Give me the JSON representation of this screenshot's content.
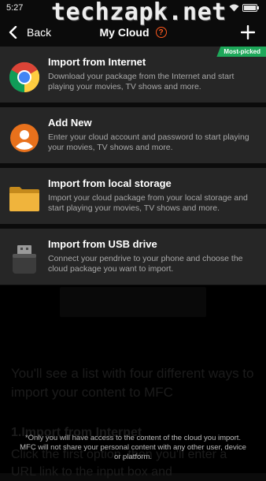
{
  "status": {
    "time": "5:27",
    "battery": "battery-icon",
    "wifi": "wifi-icon"
  },
  "watermark": "techzapk.net",
  "header": {
    "back_label": "Back",
    "title": "My Cloud",
    "help": "?",
    "add_icon": "plus-icon"
  },
  "badge": "Most-picked",
  "items": [
    {
      "title": "Import from Internet",
      "desc": "Download your package from the Internet and start playing your movies, TV shows and more.",
      "icon": "chrome-icon"
    },
    {
      "title": "Add New",
      "desc": "Enter your cloud account and password to start playing your movies, TV shows and more.",
      "icon": "user-icon"
    },
    {
      "title": "Import from local storage",
      "desc": "Import your cloud package from your local storage and start playing your movies, TV shows and more.",
      "icon": "folder-icon"
    },
    {
      "title": "Import from USB drive",
      "desc": "Connect your pendrive to your phone and choose the cloud package you want to import.",
      "icon": "usb-drive-icon"
    }
  ],
  "background": {
    "paragraph": "You'll see a list with four different ways to import your content to MFC",
    "heading": "1.Import from Internet",
    "paragraph2": "Click the first option, then you'll enter a URL link to the input box and"
  },
  "footnote": "*Only you will have access to the content of the cloud you import. MFC will not share your personal content with any other user, device or platform.",
  "colors": {
    "accent": "#ff5a1f",
    "badge": "#1ea85a",
    "card": "#262626"
  }
}
